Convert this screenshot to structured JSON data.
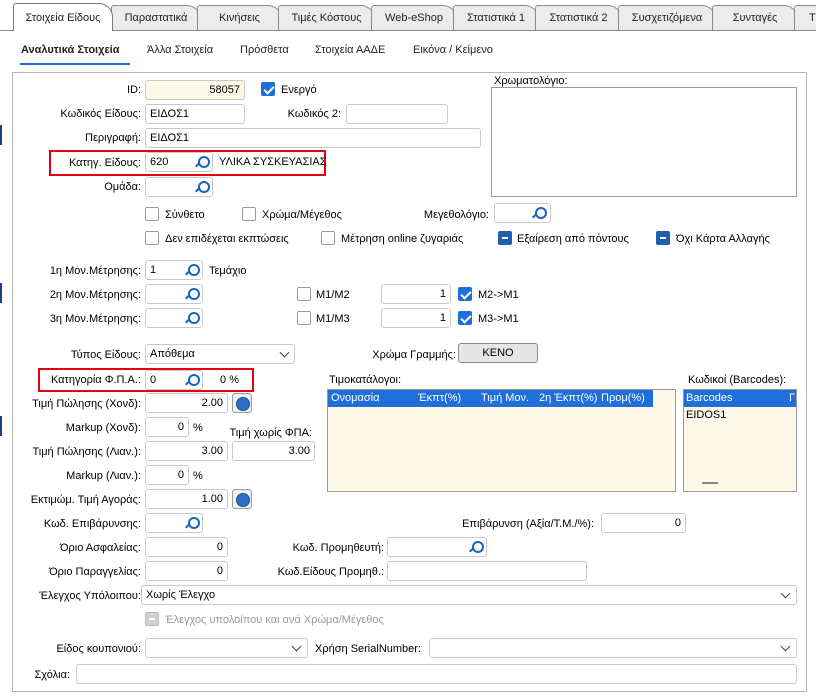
{
  "tabs": [
    "Στοιχεία Είδους",
    "Παραστατικά",
    "Κινήσεις",
    "Τιμές Κόστους",
    "Web-eShop",
    "Στατιστικά 1",
    "Στατιστικά 2",
    "Συσχετιζόμενα",
    "Συνταγές",
    "Τ"
  ],
  "subtabs": [
    "Αναλυτικά Στοιχεία",
    "Άλλα Στοιχεία",
    "Πρόσθετα",
    "Στοιχεία ΑΑΔΕ",
    "Εικόνα / Κείμενο"
  ],
  "form": {
    "id_label": "ID:",
    "id_value": "58057",
    "active_label": "Ενεργό",
    "code_label": "Κωδικός Είδους:",
    "code_value": "ΕΙΔΟΣ1",
    "code2_label": "Κωδικός 2:",
    "code2_value": "",
    "description_label": "Περιγραφή:",
    "description_value": "ΕΙΔΟΣ1",
    "category_label": "Κατηγ. Είδους:",
    "category_value": "620",
    "category_name": "ΥΛΙΚΑ ΣΥΣΚΕΥΑΣΙΑΣ",
    "group_label": "Ομάδα:",
    "group_value": "",
    "color_palette_label": "Χρωματολόγιο:",
    "composite_label": "Σύνθετο",
    "color_size_label": "Χρώμα/Μέγεθος",
    "size_scale_label": "Μεγεθολόγιο:",
    "no_discount_label": "Δεν επιδέχεται εκπτώσεις",
    "online_scale_label": "Μέτρηση online ζυγαριάς",
    "points_exclusion_label": "Εξαίρεση από πόντους",
    "no_change_card_label": "Όχι Κάρτα Αλλαγής",
    "uom1_label": "1η Μον.Μέτρησης:",
    "uom1_value": "1",
    "uom1_name": "Τεμάχιο",
    "uom2_label": "2η Μον.Μέτρησης:",
    "uom3_label": "3η Μον.Μέτρησης:",
    "m1m2_label": "Μ1/Μ2",
    "m1m2_value": "1",
    "m2m1_label": "Μ2->Μ1",
    "m1m3_label": "Μ1/Μ3",
    "m1m3_value": "1",
    "m3m1_label": "Μ3->Μ1",
    "item_type_label": "Τύπος Είδους:",
    "item_type_value": "Απόθεμα",
    "line_color_label": "Χρώμα Γραμμής:",
    "line_color_value": "ΚΕΝΟ",
    "vat_category_label": "Κατηγορία Φ.Π.Α.:",
    "vat_category_value": "0",
    "vat_percent": "0 %",
    "price_wholesale_label": "Τιμή Πώλησης (Χονδ):",
    "price_wholesale_value": "2.00",
    "markup_wholesale_label": "Markup (Χονδ):",
    "markup_wholesale_value": "0",
    "percent_sign": "%",
    "price_no_vat_label": "Τιμή χωρίς ΦΠΑ:",
    "price_no_vat_value": "3.00",
    "price_retail_label": "Τιμή Πώλησης (Λιαν.):",
    "price_retail_value": "3.00",
    "markup_retail_label": "Markup (Λιαν.):",
    "markup_retail_value": "0",
    "est_purchase_label": "Εκτιμώμ. Τιμή Αγοράς:",
    "est_purchase_value": "1.00",
    "charge_code_label": "Κωδ. Επιβάρυνσης:",
    "charge_label": "Επιβάρυνση (Αξία/Τ.Μ./%):",
    "charge_value": "0",
    "safety_limit_label": "Όριο Ασφαλείας:",
    "safety_limit_value": "0",
    "supplier_code_label": "Κωδ. Προμηθευτή:",
    "order_limit_label": "Όριο Παραγγελίας:",
    "order_limit_value": "0",
    "supplier_item_label": "Κωδ.Είδους Προμηθ.:",
    "balance_check_label": "Έλεγχος Υπόλοιπου:",
    "balance_check_value": "Χωρίς Έλεγχο",
    "balance_by_color_label": "Έλεγχος υπολοίπου και ανά Χρώμα/Μέγεθος",
    "coupon_type_label": "Είδος κουπονιού:",
    "serial_label": "Χρήση SerialNumber:",
    "comments_label": "Σχόλια:"
  },
  "price_lists": {
    "title": "Τιμοκατάλογοι:",
    "columns": [
      "Ονομασία",
      "Έκπτ(%)",
      "Τιμή Μον.",
      "2η Έκπτ(%)",
      "Προμ(%)"
    ]
  },
  "barcodes": {
    "title": "Κωδικοί (Barcodes):",
    "column": "Barcodes",
    "column2": "Γ",
    "rows": [
      "EIDOS1"
    ]
  },
  "colors": {
    "accent": "#1e6fd9",
    "highlight": "#e8000b",
    "grid_bg": "#fdf8e8"
  }
}
